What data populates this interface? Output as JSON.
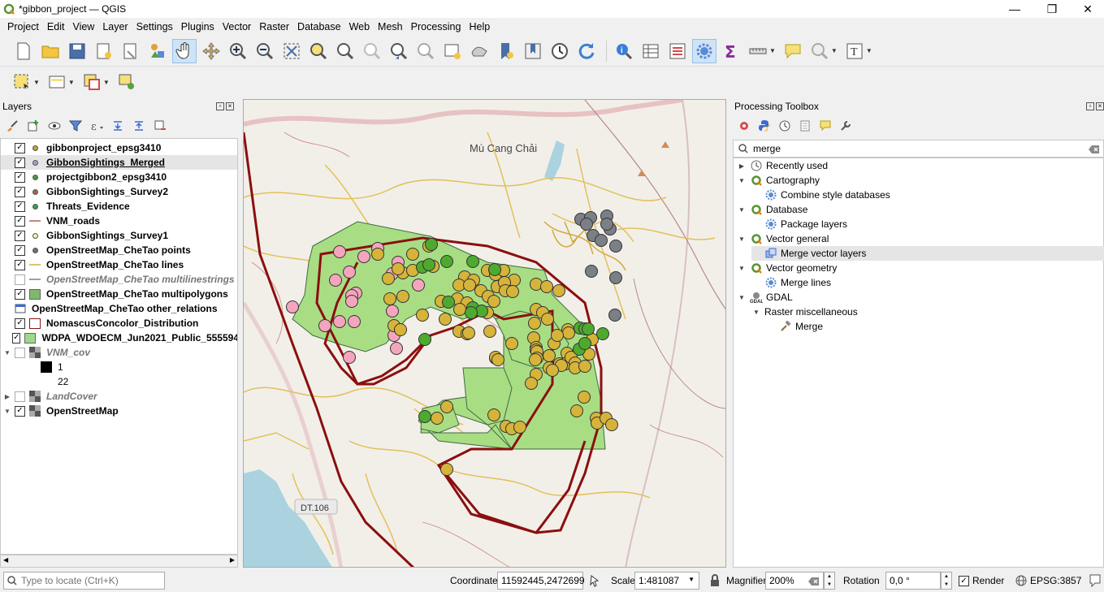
{
  "window": {
    "title": "*gibbon_project — QGIS",
    "minimize": "—",
    "maximize": "❐",
    "close": "✕"
  },
  "menu": [
    "Project",
    "Edit",
    "View",
    "Layer",
    "Settings",
    "Plugins",
    "Vector",
    "Raster",
    "Database",
    "Web",
    "Mesh",
    "Processing",
    "Help"
  ],
  "layers_panel": {
    "title": "Layers",
    "items": [
      {
        "name": "gibbonproject_epsg3410",
        "checked": true,
        "symbol": "dot",
        "color": "#c9a12d",
        "style": "bold"
      },
      {
        "name": "GibbonSightings_Merged",
        "checked": true,
        "symbol": "dot",
        "color": "#a5a0c8",
        "style": "bold-underline",
        "selected": true
      },
      {
        "name": "projectgibbon2_epsg3410",
        "checked": true,
        "symbol": "dot",
        "color": "#4a9a3c",
        "style": "bold"
      },
      {
        "name": "GibbonSightings_Survey2",
        "checked": true,
        "symbol": "dot",
        "color": "#a06a4a",
        "style": "bold"
      },
      {
        "name": "Threats_Evidence",
        "checked": true,
        "symbol": "dot",
        "color": "#3aa04a",
        "style": "bold"
      },
      {
        "name": "VNM_roads",
        "checked": true,
        "symbol": "line",
        "color": "#c8877a",
        "style": "bold"
      },
      {
        "name": "GibbonSightings_Survey1",
        "checked": true,
        "symbol": "dot",
        "color": "#f1f3a8",
        "style": "bold"
      },
      {
        "name": "OpenStreetMap_CheTao points",
        "checked": true,
        "symbol": "dot",
        "color": "#707070",
        "style": "bold"
      },
      {
        "name": "OpenStreetMap_CheTao lines",
        "checked": true,
        "symbol": "line",
        "color": "#d9c56a",
        "style": "bold"
      },
      {
        "name": "OpenStreetMap_CheTao multilinestrings",
        "checked": false,
        "symbol": "line",
        "color": "#a0a0a0",
        "style": "italic"
      },
      {
        "name": "OpenStreetMap_CheTao multipolygons",
        "checked": true,
        "symbol": "fill",
        "color": "#7fb86b",
        "style": "bold"
      },
      {
        "name": "OpenStreetMap_CheTao other_relations",
        "checked": null,
        "symbol": "table",
        "color": "#555555",
        "style": "bold"
      },
      {
        "name": "NomascusConcolor_Distribution",
        "checked": true,
        "symbol": "outline",
        "color": "#8b1414",
        "style": "bold"
      },
      {
        "name": "WDPA_WDOECM_Jun2021_Public_555594",
        "checked": true,
        "symbol": "fill",
        "color": "#9ed88a",
        "style": "bold"
      },
      {
        "name": "VNM_cov",
        "checked": false,
        "symbol": "raster",
        "color": "#555555",
        "style": "italic",
        "expand": "▼"
      },
      {
        "name": "1",
        "checked": null,
        "symbol": "swatch",
        "color": "#000000",
        "style": "plain",
        "indent": true
      },
      {
        "name": "22",
        "checked": null,
        "symbol": "swatch",
        "color": "#ffffff",
        "style": "plain",
        "indent": true
      },
      {
        "name": "LandCover",
        "checked": false,
        "symbol": "raster",
        "color": "#555555",
        "style": "italic",
        "expand": "▶"
      },
      {
        "name": "OpenStreetMap",
        "checked": true,
        "symbol": "raster",
        "color": "#555555",
        "style": "bold",
        "expand": "▼"
      }
    ]
  },
  "map": {
    "labels": {
      "town": "Mù Cang Chải",
      "road": "DT.106"
    },
    "colors": {
      "background": "#f2efe9",
      "park": "#a8dd84",
      "distribution": "#8b0f0f",
      "pink": "#f4a5bd",
      "yellow": "#d6b43a",
      "green": "#4eaa2e",
      "gray": "#7a8085",
      "road": "#e2c05a",
      "water": "#aad3df"
    }
  },
  "toolbox": {
    "title": "Processing Toolbox",
    "search": "merge",
    "tree": [
      {
        "label": "Recently used",
        "level": 0,
        "arrow": "▶",
        "icon": "clock"
      },
      {
        "label": "Cartography",
        "level": 0,
        "arrow": "▼",
        "icon": "qgis"
      },
      {
        "label": "Combine style databases",
        "level": 1,
        "arrow": "",
        "icon": "gear"
      },
      {
        "label": "Database",
        "level": 0,
        "arrow": "▼",
        "icon": "qgis"
      },
      {
        "label": "Package layers",
        "level": 1,
        "arrow": "",
        "icon": "gear"
      },
      {
        "label": "Vector general",
        "level": 0,
        "arrow": "▼",
        "icon": "qgis"
      },
      {
        "label": "Merge vector layers",
        "level": 1,
        "arrow": "",
        "icon": "merge",
        "selected": true
      },
      {
        "label": "Vector geometry",
        "level": 0,
        "arrow": "▼",
        "icon": "qgis"
      },
      {
        "label": "Merge lines",
        "level": 1,
        "arrow": "",
        "icon": "gear"
      },
      {
        "label": "GDAL",
        "level": 0,
        "arrow": "▼",
        "icon": "gdal"
      },
      {
        "label": "Raster miscellaneous",
        "level": 1,
        "arrow": "▼",
        "icon": ""
      },
      {
        "label": "Merge",
        "level": 2,
        "arrow": "",
        "icon": "hammer"
      }
    ]
  },
  "status": {
    "locate_placeholder": "Type to locate (Ctrl+K)",
    "coordinate_label": "Coordinate",
    "coordinate": "11592445,2472699",
    "scale_label": "Scale",
    "scale": "1:481087",
    "magnifier_label": "Magnifier",
    "magnifier": "200%",
    "rotation_label": "Rotation",
    "rotation": "0,0 °",
    "render_label": "Render",
    "render_checked": true,
    "crs": "EPSG:3857"
  }
}
